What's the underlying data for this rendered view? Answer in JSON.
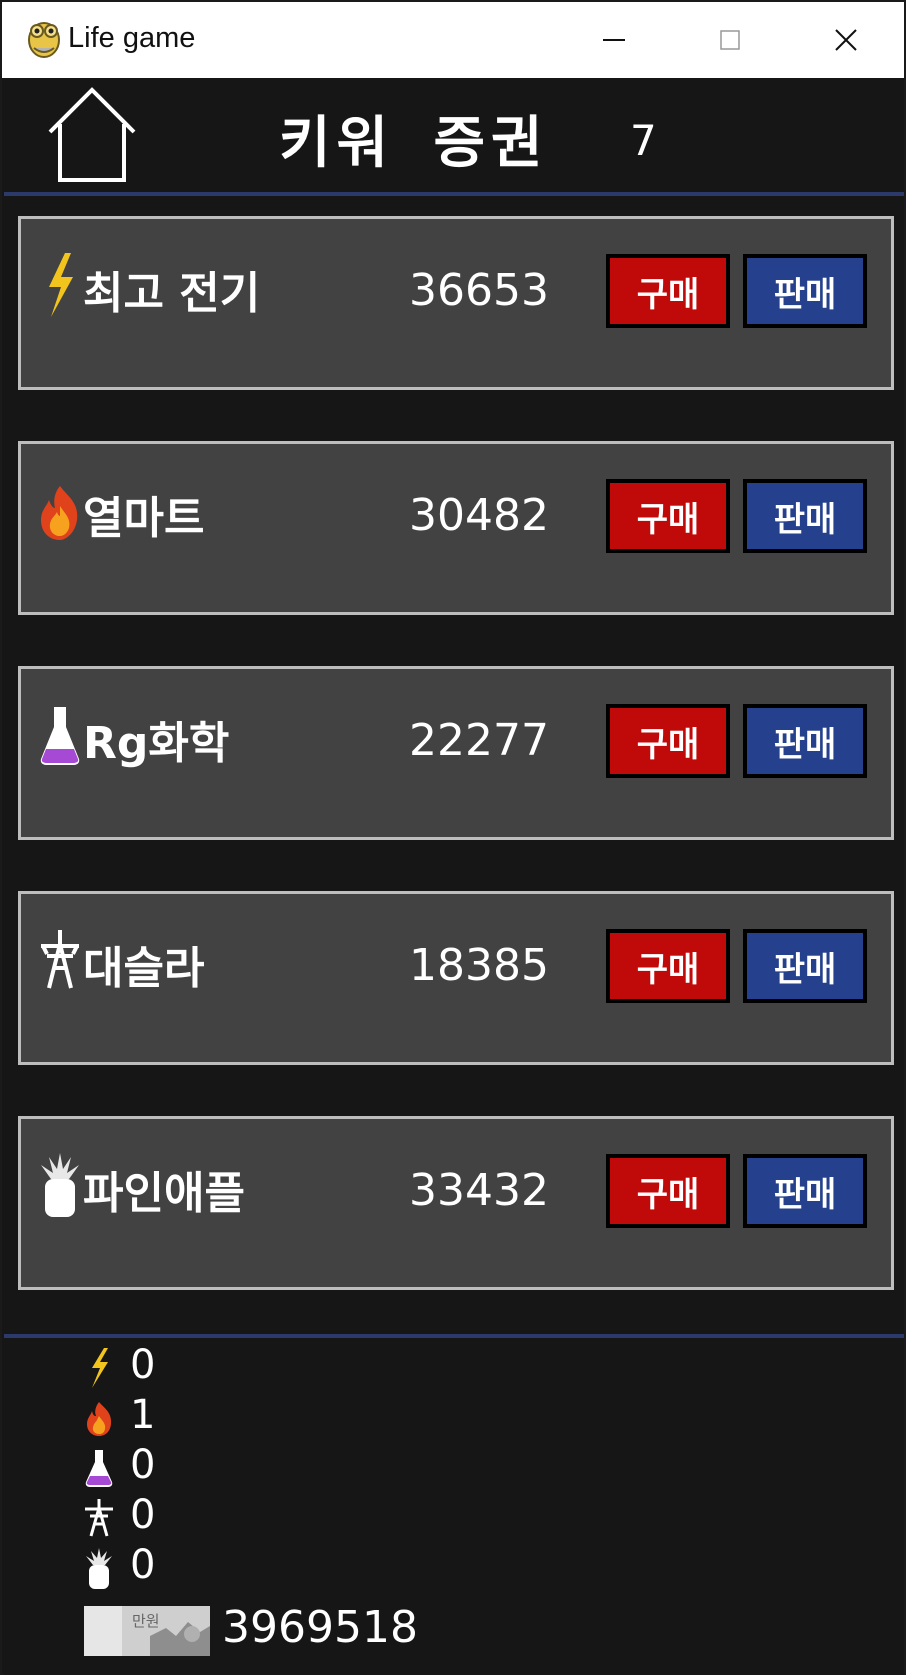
{
  "window": {
    "title": "Life game",
    "app_icon": "snake-app-icon",
    "controls": [
      "minimize-icon",
      "maximize-icon",
      "close-icon"
    ]
  },
  "header": {
    "home_icon": "home-icon",
    "title": "키워 증권",
    "turn": "7"
  },
  "buttons": {
    "buy_label": "구매",
    "sell_label": "판매"
  },
  "stocks": [
    {
      "icon": "lightning-icon",
      "name": "최고 전기",
      "price": "36653"
    },
    {
      "icon": "fire-icon",
      "name": "열마트",
      "price": "30482"
    },
    {
      "icon": "flask-icon",
      "name": "Rg화학",
      "price": "22277"
    },
    {
      "icon": "power-tower-icon",
      "name": "대슬라",
      "price": "18385"
    },
    {
      "icon": "pineapple-icon",
      "name": "파인애플",
      "price": "33432"
    }
  ],
  "holdings": [
    {
      "icon": "lightning-icon",
      "quantity": "0"
    },
    {
      "icon": "fire-icon",
      "quantity": "1"
    },
    {
      "icon": "flask-icon",
      "quantity": "0"
    },
    {
      "icon": "power-tower-icon",
      "quantity": "0"
    },
    {
      "icon": "pineapple-icon",
      "quantity": "0"
    }
  ],
  "money": {
    "icon": "banknote-icon",
    "note_text": "만원",
    "amount": "3969518"
  },
  "colors": {
    "background": "#161616",
    "row_fill": "#424242",
    "row_border": "#bdbdbd",
    "buy": "#c00a0a",
    "sell": "#25408c",
    "divider": "#2b3a6b"
  }
}
